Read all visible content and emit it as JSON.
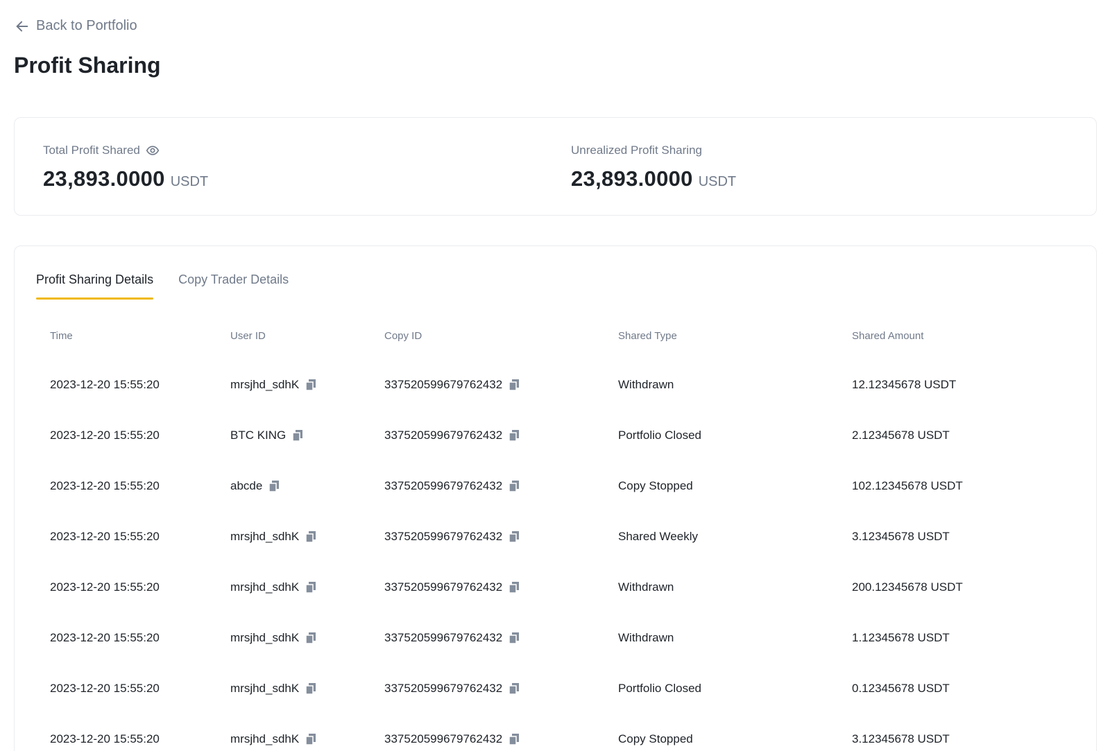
{
  "nav": {
    "back_label": "Back to Portfolio"
  },
  "page": {
    "title": "Profit Sharing"
  },
  "summary": {
    "total_label": "Total Profit Shared",
    "total_value": "23,893.0000",
    "total_unit": "USDT",
    "unrealized_label": "Unrealized Profit Sharing",
    "unrealized_value": "23,893.0000",
    "unrealized_unit": "USDT"
  },
  "tabs": [
    {
      "label": "Profit Sharing Details",
      "active": true
    },
    {
      "label": "Copy Trader Details",
      "active": false
    }
  ],
  "table": {
    "columns": [
      "Time",
      "User ID",
      "Copy ID",
      "Shared Type",
      "Shared Amount"
    ],
    "rows": [
      {
        "time": "2023-12-20 15:55:20",
        "user_id": "mrsjhd_sdhK",
        "copy_id": "337520599679762432",
        "type": "Withdrawn",
        "amount": "12.12345678 USDT"
      },
      {
        "time": "2023-12-20 15:55:20",
        "user_id": "BTC KING",
        "copy_id": "337520599679762432",
        "type": "Portfolio Closed",
        "amount": "2.12345678 USDT"
      },
      {
        "time": "2023-12-20 15:55:20",
        "user_id": "abcde",
        "copy_id": "337520599679762432",
        "type": "Copy Stopped",
        "amount": "102.12345678 USDT"
      },
      {
        "time": "2023-12-20 15:55:20",
        "user_id": "mrsjhd_sdhK",
        "copy_id": "337520599679762432",
        "type": "Shared Weekly",
        "amount": "3.12345678 USDT"
      },
      {
        "time": "2023-12-20 15:55:20",
        "user_id": "mrsjhd_sdhK",
        "copy_id": "337520599679762432",
        "type": "Withdrawn",
        "amount": "200.12345678 USDT"
      },
      {
        "time": "2023-12-20 15:55:20",
        "user_id": "mrsjhd_sdhK",
        "copy_id": "337520599679762432",
        "type": "Withdrawn",
        "amount": "1.12345678 USDT"
      },
      {
        "time": "2023-12-20 15:55:20",
        "user_id": "mrsjhd_sdhK",
        "copy_id": "337520599679762432",
        "type": "Portfolio Closed",
        "amount": "0.12345678 USDT"
      },
      {
        "time": "2023-12-20 15:55:20",
        "user_id": "mrsjhd_sdhK",
        "copy_id": "337520599679762432",
        "type": "Copy Stopped",
        "amount": "3.12345678 USDT"
      }
    ]
  },
  "icons": {
    "back": "arrow-left-icon",
    "visibility": "eye-icon",
    "copy": "copy-icon"
  },
  "colors": {
    "accent": "#F0B90B",
    "text_primary": "#1E2329",
    "text_secondary": "#707A8A",
    "border": "#EAECEF"
  }
}
